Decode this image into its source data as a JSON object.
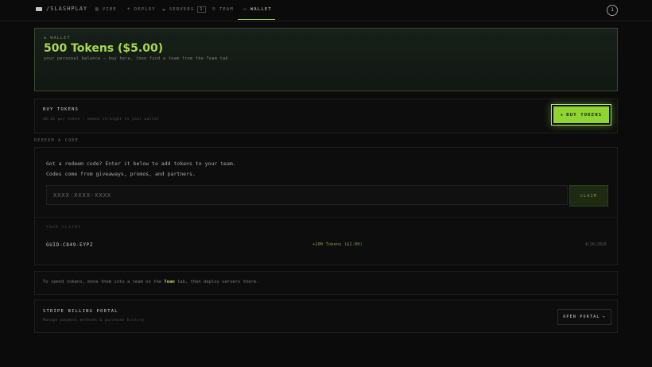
{
  "nav": {
    "logo": "/SLASHPLAY",
    "items": [
      {
        "label": "VIBE",
        "icon": "vibe-icon"
      },
      {
        "label": "DEPLOY",
        "icon": "deploy-icon"
      },
      {
        "label": "SERVERS",
        "icon": "servers-icon",
        "count": "1"
      },
      {
        "label": "TEAM",
        "icon": "team-icon"
      },
      {
        "label": "WALLET",
        "icon": "wallet-icon"
      }
    ],
    "active": "WALLET",
    "avatar": "1"
  },
  "wallet": {
    "label": "WALLET",
    "balance": "500 Tokens ($5.00)",
    "subtitle": "your personal balance — buy here, then fund a team from the Team tab"
  },
  "buy": {
    "title": "BUY TOKENS",
    "subtitle": "$0.01 per token — added straight to your wallet",
    "button": "BUY TOKENS"
  },
  "redeem": {
    "heading": "REDEEM A CODE",
    "text": "Got a redeem code? Enter it below to add tokens to your team. Codes come from giveaways, promos, and partners.",
    "placeholder": "XXXX-XXXX-XXXX",
    "claim_button": "CLAIM",
    "claims_label": "YOUR CLAIMS",
    "claims": [
      {
        "code": "GUID-C849-EYPZ",
        "amount": "+100 Tokens ($1.00)",
        "date": "4/26/2026"
      }
    ]
  },
  "spend": {
    "text_before": "To spend tokens, move them into a team on the ",
    "link": "Team",
    "text_after": " tab, then deploy servers there."
  },
  "stripe": {
    "title": "STRIPE BILLING PORTAL",
    "subtitle": "Manage payment methods & purchase history",
    "button": "OPEN PORTAL"
  },
  "colors": {
    "accent": "#8fd432",
    "background": "#0b0b0b"
  }
}
